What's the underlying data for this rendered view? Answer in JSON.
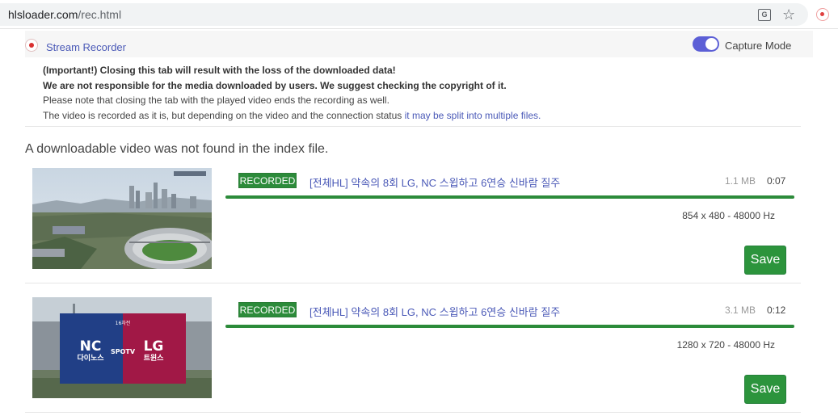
{
  "browser": {
    "url_host": "hlsloader.com",
    "url_path": "/rec.html"
  },
  "header": {
    "brand": "Stream Recorder",
    "capture_mode_label": "Capture Mode",
    "capture_mode_on": true
  },
  "notice": {
    "line1": "(Important!) Closing this tab will result with the loss of the downloaded data!",
    "line2": "We are not responsible for the media downloaded by users. We suggest checking the copyright of it.",
    "line3": "Please note that closing the tab with the played video ends the recording as well.",
    "line4_prefix": "The video is recorded as it is, but depending on the video and the connection status ",
    "line4_link": "it may be split into multiple files."
  },
  "status_message": "A downloadable video was not found in the index file.",
  "recordings": [
    {
      "badge": "RECORDED",
      "title": "[전체HL] 약속의 8회 LG, NC 스윕하고 6연승 신바람 질주",
      "size": "1.1 MB",
      "duration": "0:07",
      "progress": 1.0,
      "resolution": "854 x 480 - 48000 Hz",
      "save_label": "Save"
    },
    {
      "badge": "RECORDED",
      "title": "[전체HL] 약속의 8회 LG, NC 스윕하고 6연승 신바람 질주",
      "size": "3.1 MB",
      "duration": "0:12",
      "progress": 1.0,
      "resolution": "1280 x 720 - 48000 Hz",
      "save_label": "Save",
      "thumb_text": {
        "team_left": "NC",
        "team_left_sub": "다이노스",
        "team_right": "LG",
        "team_right_sub": "트윈스",
        "center": "SPOTV"
      }
    }
  ],
  "colors": {
    "accent": "#4a59b7",
    "recorded_green": "#2c8b3a",
    "toggle": "#5c5fd6"
  }
}
